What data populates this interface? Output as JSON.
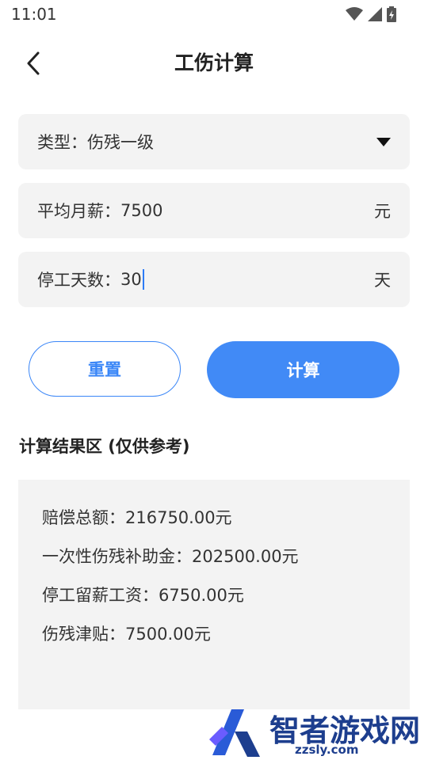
{
  "status": {
    "time": "11:01"
  },
  "header": {
    "title": "工伤计算"
  },
  "form": {
    "type_label": "类型：",
    "type_value": "伤残一级",
    "salary_label": "平均月薪：",
    "salary_value": "7500",
    "salary_unit": "元",
    "days_label": "停工天数：",
    "days_value": "30",
    "days_unit": "天"
  },
  "buttons": {
    "reset": "重置",
    "calculate": "计算"
  },
  "results": {
    "title": "计算结果区 (仅供参考)",
    "lines": [
      "赔偿总额：216750.00元",
      "一次性伤残补助金：202500.00元",
      "停工留薪工资：6750.00元",
      "伤残津贴：7500.00元"
    ]
  },
  "watermark": {
    "brand": "智者游戏网",
    "url": "zzsly.com"
  },
  "colors": {
    "accent": "#418af6",
    "field_bg": "#f3f3f3"
  }
}
